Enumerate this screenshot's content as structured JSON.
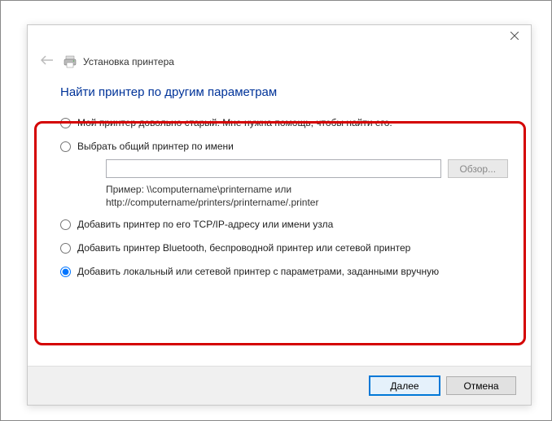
{
  "window": {
    "title": "Установка принтера",
    "heading": "Найти принтер по другим параметрам"
  },
  "options": {
    "old": "Мой принтер довольно старый. Мне нужна помощь, чтобы найти его.",
    "shared": "Выбрать общий принтер по имени",
    "shared_browse": "Обзор...",
    "shared_example_l1": "Пример: \\\\computername\\printername или",
    "shared_example_l2": "http://computername/printers/printername/.printer",
    "tcpip": "Добавить принтер по его TCP/IP-адресу или имени узла",
    "bluetooth": "Добавить принтер Bluetooth, беспроводной принтер или сетевой принтер",
    "local": "Добавить локальный или сетевой принтер с параметрами, заданными вручную"
  },
  "footer": {
    "next": "Далее",
    "cancel": "Отмена"
  }
}
